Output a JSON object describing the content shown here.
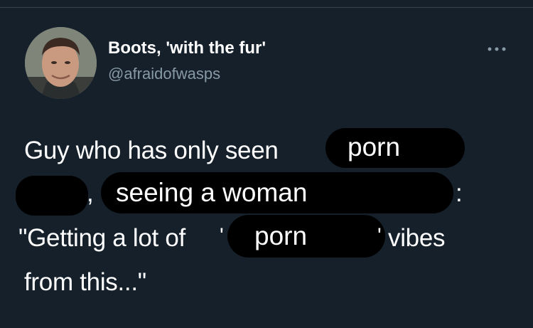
{
  "tweet": {
    "display_name": "Boots, 'with the fur'",
    "handle": "@afraidofwasps",
    "more_icon": "more-horizontal-icon",
    "avatar_icon": "profile-avatar",
    "line1": "Guy who has only seen",
    "line2_comma": ",",
    "line2_colon": ":",
    "line3_start": "\"Getting a lot of",
    "line3_quote_open": "'",
    "line3_quote_close": "'",
    "line3_end": "vibes",
    "line4": "from this...\"",
    "overlay_1": "porn",
    "overlay_2": "seeing a woman",
    "overlay_3": "porn"
  },
  "colors": {
    "background": "#15202b",
    "text": "#ffffff",
    "secondary_text": "#8899a6",
    "redaction": "#000000"
  }
}
